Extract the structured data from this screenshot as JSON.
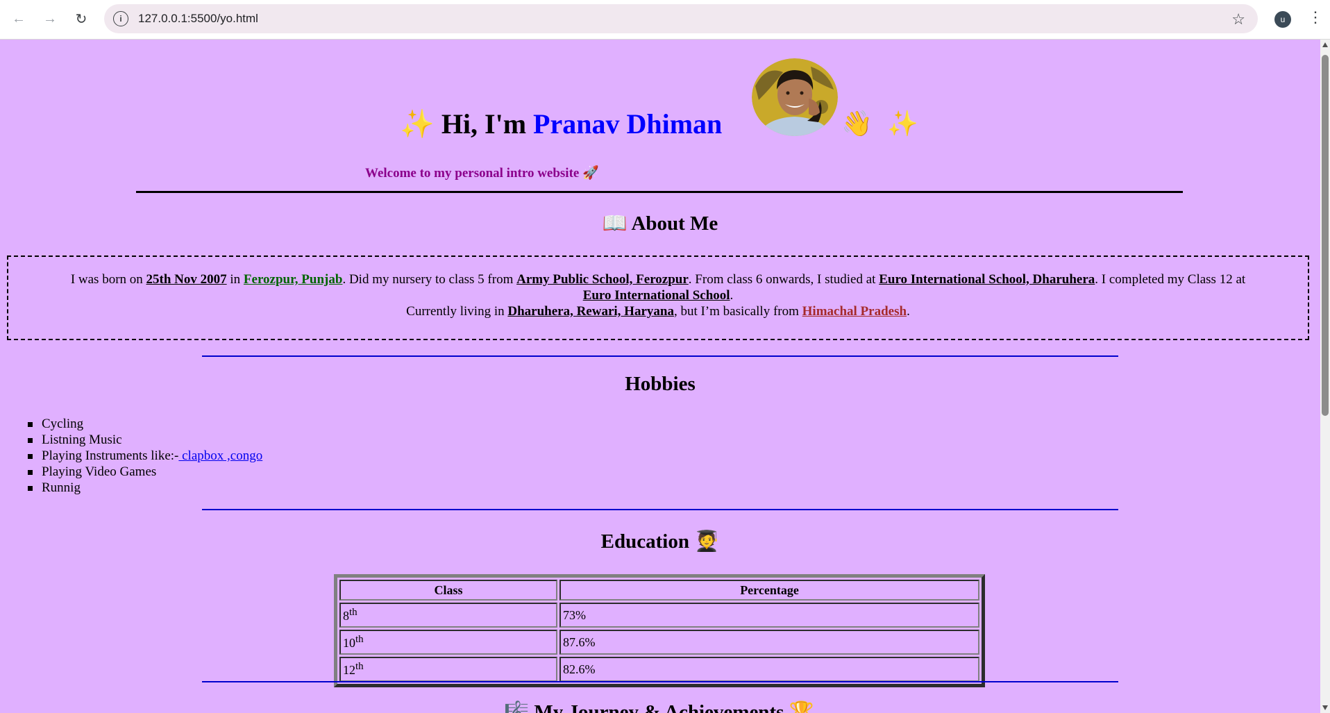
{
  "browser": {
    "url": "127.0.0.1:5500/yo.html",
    "profile_initial": "u"
  },
  "header": {
    "sparkle_left": "✨",
    "greeting": "Hi, I'm ",
    "name": "Pranav Dhiman",
    "wave": "👋",
    "sparkle_right": "✨",
    "welcome": "Welcome to my personal intro website 🚀"
  },
  "about": {
    "title": "📖 About Me",
    "t1": "I was born on ",
    "birthdate": "25th Nov 2007",
    "t2": " in ",
    "birthplace": "Ferozpur, Punjab",
    "t3": ". Did my nursery to class 5 from ",
    "school1": "Army Public School, Ferozpur",
    "t4": ". From class 6 onwards, I studied at ",
    "school2": "Euro International School, Dharuhera",
    "t5": ". I completed my Class 12 at ",
    "school3": "Euro International School",
    "t6": ".",
    "t7": "Currently living in ",
    "current": "Dharuhera, Rewari, Haryana",
    "t8": ", but I’m basically from ",
    "origin": "Himachal Pradesh",
    "t9": "."
  },
  "hobbies": {
    "title": "Hobbies",
    "items": [
      "Cycling",
      "Listning Music",
      "Playing Instruments like:-",
      "Playing Video Games",
      "Runnig"
    ],
    "instruments_link": " clapbox ,congo"
  },
  "education": {
    "title": "Education 🧑‍🎓",
    "headers": [
      "Class",
      "Percentage"
    ],
    "rows": [
      {
        "class": "8",
        "sup": "th",
        "percent": "73%"
      },
      {
        "class": "10",
        "sup": "th",
        "percent": "87.6%"
      },
      {
        "class": "12",
        "sup": "th",
        "percent": "82.6%"
      }
    ]
  },
  "next_section": {
    "title": "🎼 My Journey & Achievements 🏆"
  },
  "colors": {
    "background": "#e0b0ff",
    "name": "#0000ff",
    "welcome": "#8b008b",
    "green_link": "#006400",
    "brown_link": "#a52a2a",
    "divider_blue": "#0000cd"
  }
}
